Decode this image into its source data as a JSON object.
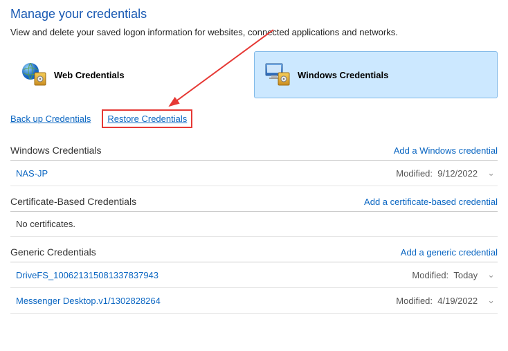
{
  "title": "Manage your credentials",
  "subtitle": "View and delete your saved logon information for websites, connected applications and networks.",
  "tabs": {
    "web": "Web Credentials",
    "windows": "Windows Credentials"
  },
  "links": {
    "backup": "Back up Credentials",
    "restore": "Restore Credentials"
  },
  "sections": {
    "windows": {
      "title": "Windows Credentials",
      "addLabel": "Add a Windows credential",
      "items": [
        {
          "name": "NAS-JP",
          "modifiedLabel": "Modified:",
          "modified": "9/12/2022"
        }
      ]
    },
    "cert": {
      "title": "Certificate-Based Credentials",
      "addLabel": "Add a certificate-based credential",
      "empty": "No certificates."
    },
    "generic": {
      "title": "Generic Credentials",
      "addLabel": "Add a generic credential",
      "items": [
        {
          "name": "DriveFS_100621315081337837943",
          "modifiedLabel": "Modified:",
          "modified": "Today"
        },
        {
          "name": "Messenger Desktop.v1/1302828264",
          "modifiedLabel": "Modified:",
          "modified": "4/19/2022"
        }
      ]
    }
  }
}
